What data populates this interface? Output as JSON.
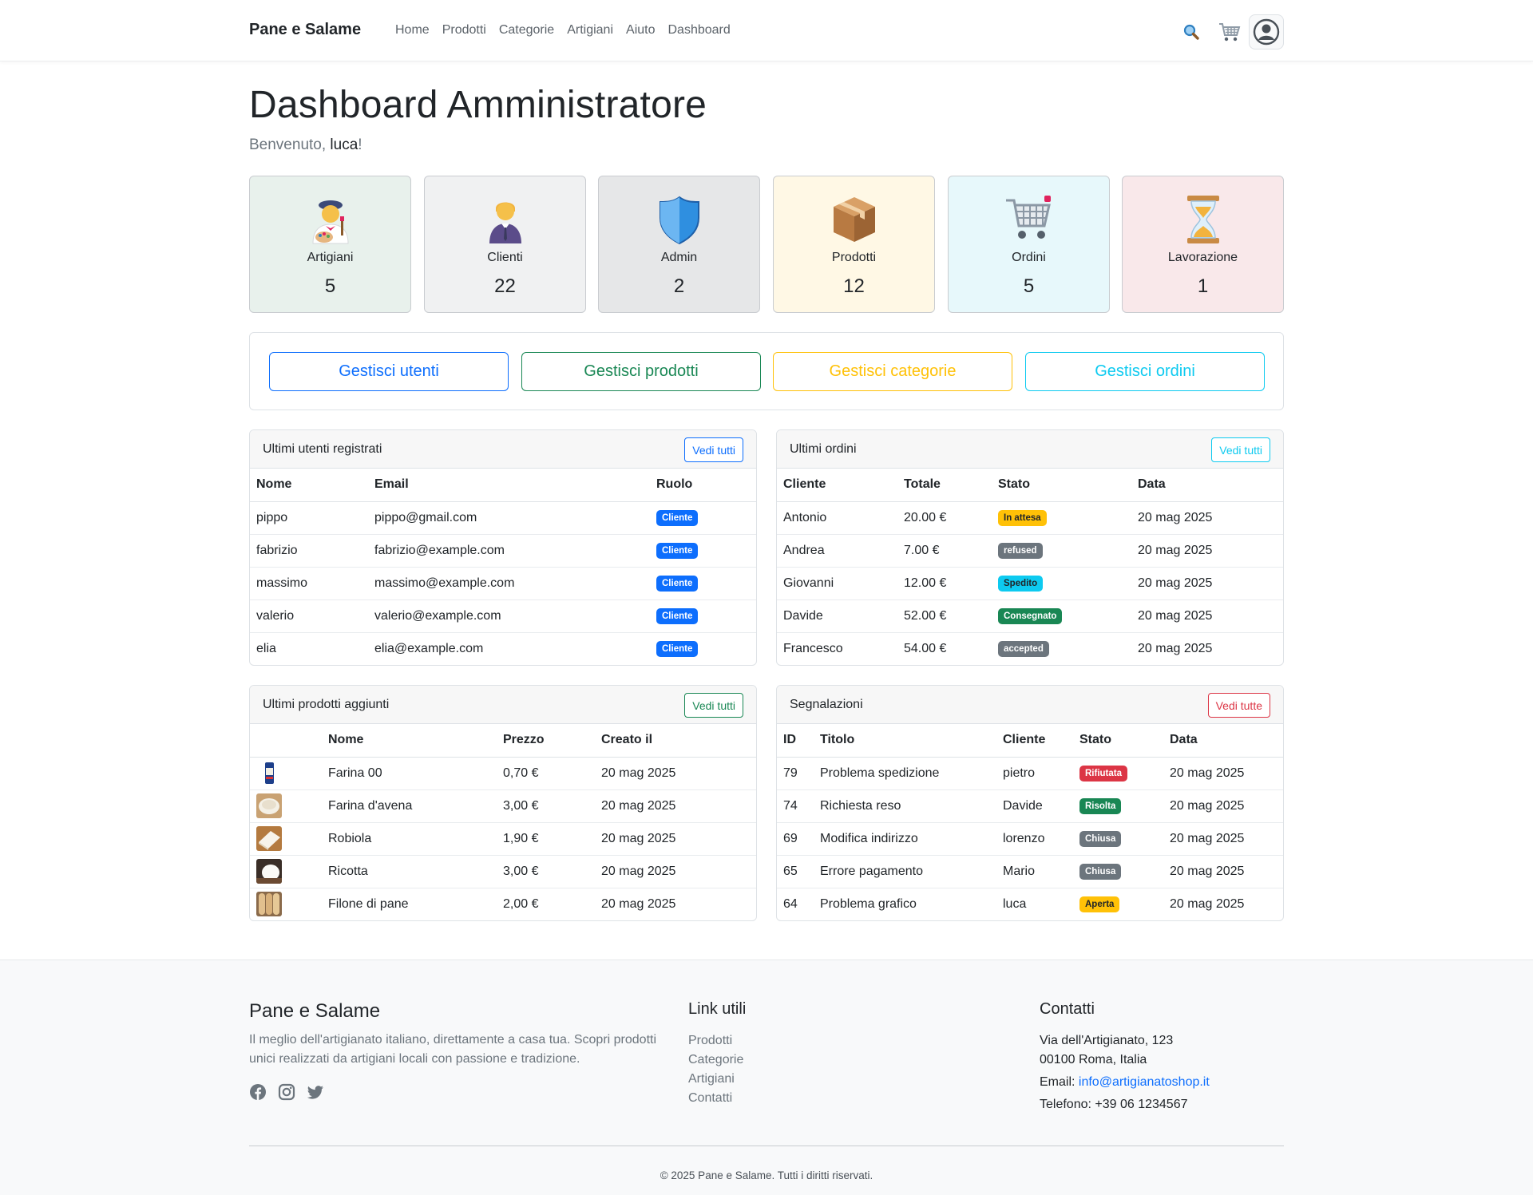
{
  "nav": {
    "brand": "Pane e Salame",
    "links": [
      "Home",
      "Prodotti",
      "Categorie",
      "Artigiani",
      "Aiuto",
      "Dashboard"
    ],
    "icons": [
      "search-icon",
      "cart-icon",
      "user-avatar-icon"
    ]
  },
  "header": {
    "title": "Dashboard Amministratore",
    "welcome_prefix": "Benvenuto, ",
    "username": "luca",
    "welcome_suffix": "!"
  },
  "stats": [
    {
      "label": "Artigiani",
      "value": "5",
      "icon": "artist-icon",
      "bg": "#e8f1ec"
    },
    {
      "label": "Clienti",
      "value": "22",
      "icon": "person-icon",
      "bg": "#f0f1f2"
    },
    {
      "label": "Admin",
      "value": "2",
      "icon": "shield-icon",
      "bg": "#e6e7e8"
    },
    {
      "label": "Prodotti",
      "value": "12",
      "icon": "package-icon",
      "bg": "#fff8e5"
    },
    {
      "label": "Ordini",
      "value": "5",
      "icon": "shopping-cart-icon",
      "bg": "#e7f8fb"
    },
    {
      "label": "Lavorazione",
      "value": "1",
      "icon": "hourglass-icon",
      "bg": "#f9e8ea"
    }
  ],
  "actions": [
    {
      "label": "Gestisci utenti",
      "color": "#0d6efd"
    },
    {
      "label": "Gestisci prodotti",
      "color": "#198754"
    },
    {
      "label": "Gestisci categorie",
      "color": "#ffc107"
    },
    {
      "label": "Gestisci ordini",
      "color": "#0dcaf0"
    }
  ],
  "users_panel": {
    "title": "Ultimi utenti registrati",
    "button": "Vedi tutti",
    "button_color": "#0d6efd",
    "columns": [
      "Nome",
      "Email",
      "Ruolo"
    ],
    "rows": [
      {
        "name": "pippo",
        "email": "pippo@gmail.com",
        "role": "Cliente"
      },
      {
        "name": "fabrizio",
        "email": "fabrizio@example.com",
        "role": "Cliente"
      },
      {
        "name": "massimo",
        "email": "massimo@example.com",
        "role": "Cliente"
      },
      {
        "name": "valerio",
        "email": "valerio@example.com",
        "role": "Cliente"
      },
      {
        "name": "elia",
        "email": "elia@example.com",
        "role": "Cliente"
      }
    ],
    "role_color": "#0d6efd"
  },
  "orders_panel": {
    "title": "Ultimi ordini",
    "button": "Vedi tutti",
    "button_color": "#0dcaf0",
    "columns": [
      "Cliente",
      "Totale",
      "Stato",
      "Data"
    ],
    "rows": [
      {
        "cliente": "Antonio",
        "totale": "20.00 €",
        "stato": "In attesa",
        "color": "#ffc107",
        "text": "#212529",
        "data": "20 mag 2025"
      },
      {
        "cliente": "Andrea",
        "totale": "7.00 €",
        "stato": "refused",
        "color": "#6c757d",
        "text": "#ffffff",
        "data": "20 mag 2025"
      },
      {
        "cliente": "Giovanni",
        "totale": "12.00 €",
        "stato": "Spedito",
        "color": "#0dcaf0",
        "text": "#212529",
        "data": "20 mag 2025"
      },
      {
        "cliente": "Davide",
        "totale": "52.00 €",
        "stato": "Consegnato",
        "color": "#198754",
        "text": "#ffffff",
        "data": "20 mag 2025"
      },
      {
        "cliente": "Francesco",
        "totale": "54.00 €",
        "stato": "accepted",
        "color": "#6c757d",
        "text": "#ffffff",
        "data": "20 mag 2025"
      }
    ]
  },
  "products_panel": {
    "title": "Ultimi prodotti aggiunti",
    "button": "Vedi tutti",
    "button_color": "#198754",
    "columns": [
      "",
      "Nome",
      "Prezzo",
      "Creato il"
    ],
    "rows": [
      {
        "nome": "Farina 00",
        "prezzo": "0,70 €",
        "data": "20 mag 2025",
        "thumb": "flour-package-thumbnail"
      },
      {
        "nome": "Farina d'avena",
        "prezzo": "3,00 €",
        "data": "20 mag 2025",
        "thumb": "oat-flour-thumbnail"
      },
      {
        "nome": "Robiola",
        "prezzo": "1,90 €",
        "data": "20 mag 2025",
        "thumb": "robiola-cheese-thumbnail"
      },
      {
        "nome": "Ricotta",
        "prezzo": "3,00 €",
        "data": "20 mag 2025",
        "thumb": "ricotta-thumbnail"
      },
      {
        "nome": "Filone di pane",
        "prezzo": "2,00 €",
        "data": "20 mag 2025",
        "thumb": "bread-loaf-thumbnail"
      }
    ]
  },
  "reports_panel": {
    "title": "Segnalazioni",
    "button": "Vedi tutte",
    "button_color": "#dc3545",
    "columns": [
      "ID",
      "Titolo",
      "Cliente",
      "Stato",
      "Data"
    ],
    "rows": [
      {
        "id": "79",
        "titolo": "Problema spedizione",
        "cliente": "pietro",
        "stato": "Rifiutata",
        "color": "#dc3545",
        "text": "#ffffff",
        "data": "20 mag 2025"
      },
      {
        "id": "74",
        "titolo": "Richiesta reso",
        "cliente": "Davide",
        "stato": "Risolta",
        "color": "#198754",
        "text": "#ffffff",
        "data": "20 mag 2025"
      },
      {
        "id": "69",
        "titolo": "Modifica indirizzo",
        "cliente": "lorenzo",
        "stato": "Chiusa",
        "color": "#6c757d",
        "text": "#ffffff",
        "data": "20 mag 2025"
      },
      {
        "id": "65",
        "titolo": "Errore pagamento",
        "cliente": "Mario",
        "stato": "Chiusa",
        "color": "#6c757d",
        "text": "#ffffff",
        "data": "20 mag 2025"
      },
      {
        "id": "64",
        "titolo": "Problema grafico",
        "cliente": "luca",
        "stato": "Aperta",
        "color": "#ffc107",
        "text": "#212529",
        "data": "20 mag 2025"
      }
    ]
  },
  "footer": {
    "brand": "Pane e Salame",
    "description": "Il meglio dell'artigianato italiano, direttamente a casa tua. Scopri prodotti unici realizzati da artigiani locali con passione e tradizione.",
    "social": [
      "facebook-icon",
      "instagram-icon",
      "twitter-icon"
    ],
    "links_title": "Link utili",
    "links": [
      "Prodotti",
      "Categorie",
      "Artigiani",
      "Contatti"
    ],
    "contacts_title": "Contatti",
    "address1": "Via dell'Artigianato, 123",
    "address2": "00100 Roma, Italia",
    "email_label": "Email: ",
    "email": "info@artigianatoshop.it",
    "phone": "Telefono: +39 06 1234567",
    "copyright": "© 2025 Pane e Salame. Tutti i diritti riservati."
  }
}
